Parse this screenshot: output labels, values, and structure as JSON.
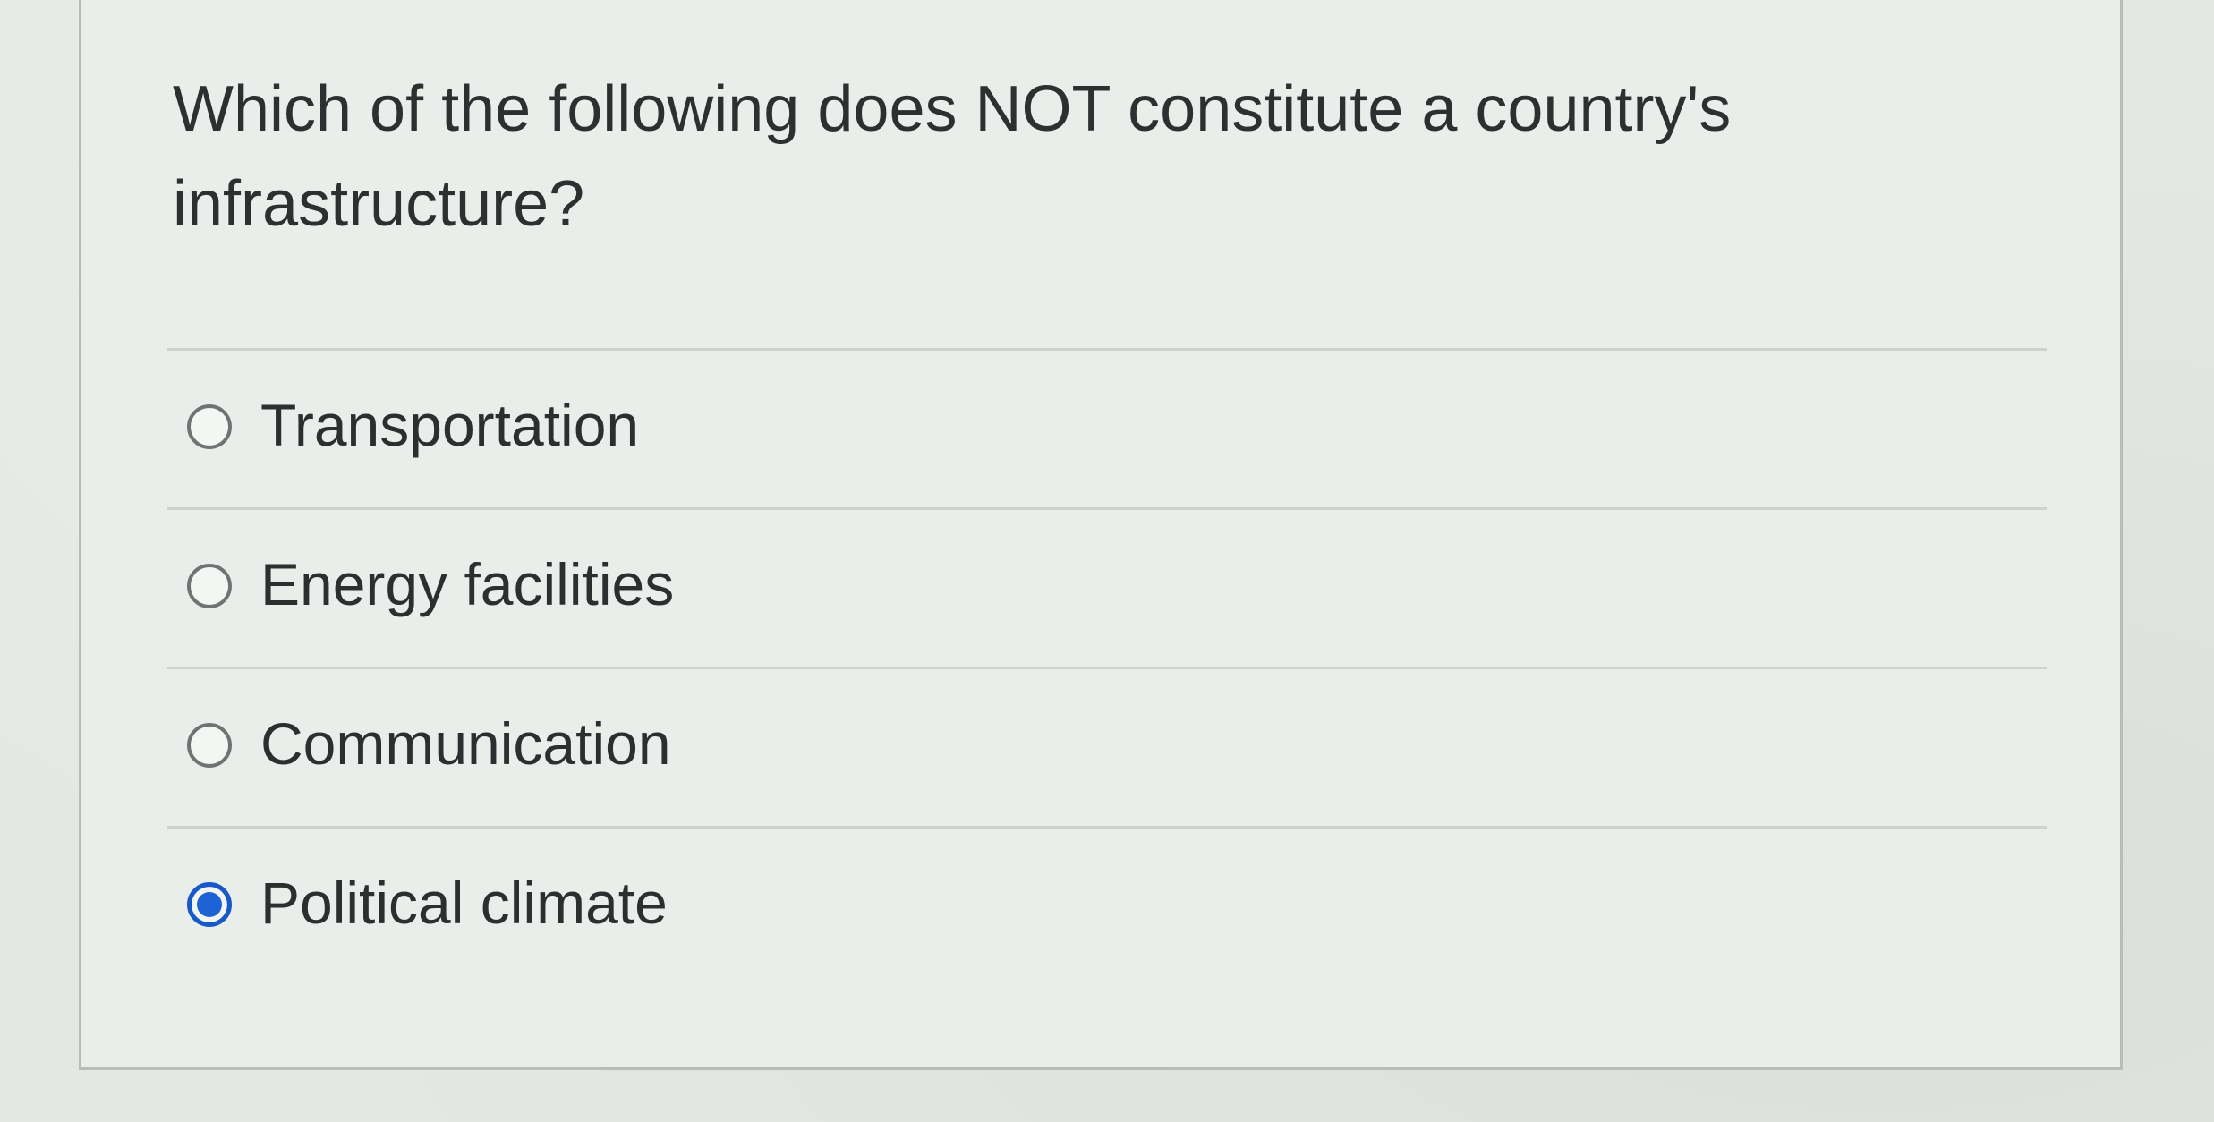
{
  "question": {
    "text": "Which of the following does NOT constitute a country's infrastructure?"
  },
  "answers": [
    {
      "label": "Transportation",
      "selected": false
    },
    {
      "label": "Energy facilities",
      "selected": false
    },
    {
      "label": "Communication",
      "selected": false
    },
    {
      "label": "Political climate",
      "selected": true
    }
  ],
  "colors": {
    "radio_selected": "#1e63d6",
    "text": "#2d2f30",
    "divider": "#cfd3cf"
  }
}
